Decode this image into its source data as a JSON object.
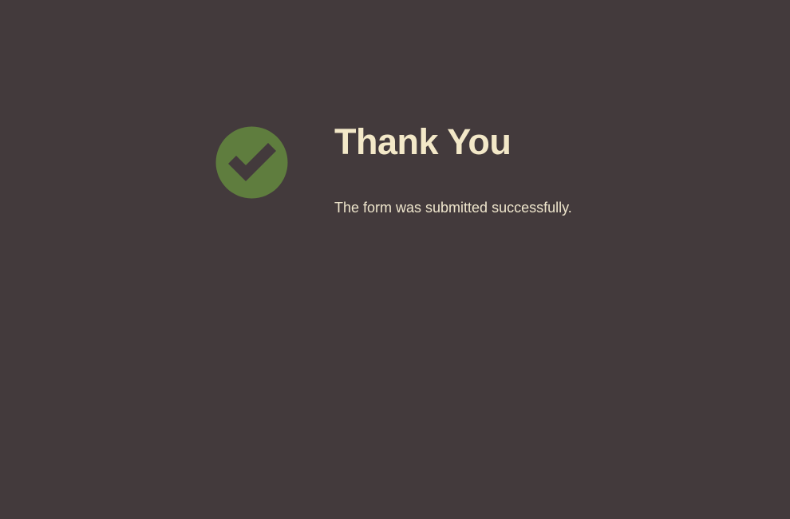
{
  "page": {
    "background_color": "#433a3c"
  },
  "confirmation": {
    "icon": {
      "name": "check-circle-icon",
      "circle_color": "#5f7d3e",
      "check_color": "#433a3c"
    },
    "title": "Thank You",
    "title_color": "#f3e8c8",
    "message": "The form was submitted successfully.",
    "message_color": "#eee5cc"
  }
}
